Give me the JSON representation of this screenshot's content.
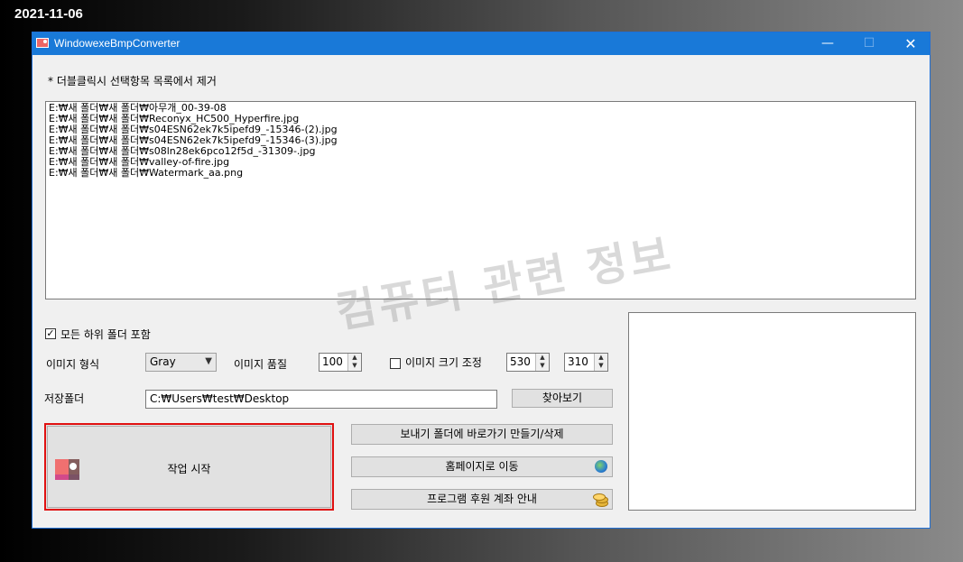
{
  "date_stamp": "2021-11-06",
  "window": {
    "title": "WindowexeBmpConverter",
    "min_glyph": "—",
    "max_glyph": "☐",
    "close_glyph": "✕"
  },
  "note": "* 더블클릭시 선택항목 목록에서 제거",
  "files": [
    "E:₩새 폴더₩새 폴더₩아무개_00-39-08",
    "E:₩새 폴더₩새 폴더₩Reconyx_HC500_Hyperfire.jpg",
    "E:₩새 폴더₩새 폴더₩s04ESN62ek7k5ipefd9_-15346-(2).jpg",
    "E:₩새 폴더₩새 폴더₩s04ESN62ek7k5ipefd9_-15346-(3).jpg",
    "E:₩새 폴더₩새 폴더₩s08ln28ek6pco12f5d_-31309-.jpg",
    "E:₩새 폴더₩새 폴더₩valley-of-fire.jpg",
    "E:₩새 폴더₩새 폴더₩Watermark_aa.png"
  ],
  "include_subfolders": {
    "label": "모든 하위 폴더 포함",
    "checked": true
  },
  "image_format": {
    "label": "이미지 형식",
    "value": "Gray"
  },
  "image_quality": {
    "label": "이미지 품질",
    "value": "100"
  },
  "resize": {
    "label": "이미지 크기 조정",
    "checked": false,
    "width": "530",
    "height": "310"
  },
  "save_folder": {
    "label": "저장폴더",
    "path": "C:₩Users₩test₩Desktop",
    "browse_label": "찾아보기"
  },
  "buttons": {
    "start": "작업 시작",
    "shortcut": "보내기 폴더에 바로가기 만들기/삭제",
    "homepage": "홈페이지로 이동",
    "donate": "프로그램 후원 계좌 안내"
  },
  "watermark_text": "컴퓨터 관련 정보",
  "icons": {
    "app": "app-image-icon",
    "start": "image-icon",
    "homepage": "globe-icon",
    "donate": "coins-icon"
  }
}
